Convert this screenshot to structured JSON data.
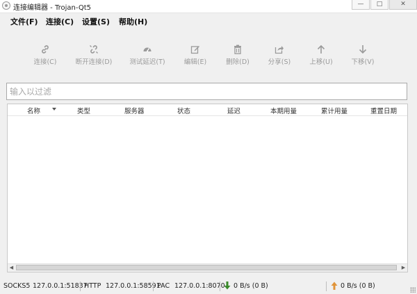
{
  "window": {
    "title": "连接编辑器 - Trojan-Qt5"
  },
  "window_controls": {
    "minimize": "—",
    "maximize": "□",
    "close": "✕"
  },
  "menu": [
    {
      "label": "文件(F)"
    },
    {
      "label": "连接(C)"
    },
    {
      "label": "设置(S)"
    },
    {
      "label": "帮助(H)"
    }
  ],
  "toolbar": [
    {
      "label": "连接(C)",
      "icon": "link-icon"
    },
    {
      "label": "断开连接(D)",
      "icon": "unlink-icon"
    },
    {
      "label": "测试延迟(T)",
      "icon": "speedometer-icon"
    },
    {
      "label": "编辑(E)",
      "icon": "edit-icon"
    },
    {
      "label": "删除(D)",
      "icon": "trash-icon"
    },
    {
      "label": "分享(S)",
      "icon": "share-icon"
    },
    {
      "label": "上移(U)",
      "icon": "arrow-up-icon"
    },
    {
      "label": "下移(V)",
      "icon": "arrow-down-icon"
    }
  ],
  "filter": {
    "placeholder": "输入以过滤",
    "value": ""
  },
  "table": {
    "columns": [
      "名称",
      "类型",
      "服务器",
      "状态",
      "延迟",
      "本期用量",
      "累计用量",
      "重置日期"
    ],
    "sort_column": "名称",
    "sort_order": "descending",
    "rows": []
  },
  "status": {
    "socks_label": "SOCKS5",
    "socks_addr": "127.0.0.1:51837",
    "http_label": "HTTP",
    "http_addr": "127.0.0.1:58591",
    "pac_label": "PAC",
    "pac_addr": "127.0.0.1:8070",
    "download": "0 B/s (0 B)",
    "upload": "0 B/s (0 B)"
  },
  "colors": {
    "download_arrow": "#3a8a2a",
    "upload_arrow": "#e0943a",
    "disabled_icon": "#9a9a9a"
  }
}
